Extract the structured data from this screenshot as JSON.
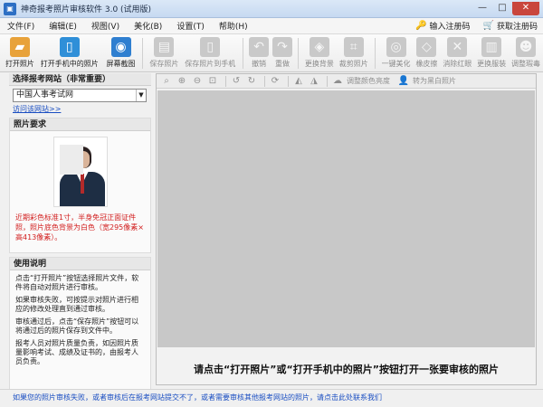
{
  "window": {
    "title": "神奇报考照片审核软件 3.0 (试用版)"
  },
  "menu": {
    "items": [
      "文件(F)",
      "编辑(E)",
      "视图(V)",
      "美化(B)",
      "设置(T)",
      "帮助(H)"
    ],
    "register_label": "输入注册码",
    "buy_label": "获取注册码"
  },
  "toolbar": {
    "buttons": [
      {
        "label": "打开照片",
        "icon": "folder-icon",
        "color": "#e8a23a"
      },
      {
        "label": "打开手机中的照片",
        "icon": "phone-icon",
        "color": "#2f8fd8"
      },
      {
        "label": "屏幕截图",
        "icon": "camera-icon",
        "color": "#2f7fd0"
      },
      {
        "label": "保存照片",
        "icon": "save-icon"
      },
      {
        "label": "保存照片到手机",
        "icon": "phone-save-icon"
      },
      {
        "label": "撤销",
        "icon": "undo-icon"
      },
      {
        "label": "重做",
        "icon": "redo-icon"
      },
      {
        "label": "更换背景",
        "icon": "background-icon"
      },
      {
        "label": "裁剪照片",
        "icon": "crop-icon"
      },
      {
        "label": "一键美化",
        "icon": "beautify-icon"
      },
      {
        "label": "橡皮擦",
        "icon": "eraser-icon"
      },
      {
        "label": "消除红眼",
        "icon": "red-eye-icon"
      },
      {
        "label": "更换服装",
        "icon": "clothes-icon"
      },
      {
        "label": "调整瑕毒",
        "icon": "head-icon"
      }
    ]
  },
  "canvas_toolbar": {
    "brightness_label": "调整颜色亮度",
    "grayscale_label": "转为黑白照片"
  },
  "left": {
    "site_title": "选择报考网站（非常重要）",
    "site_value": "中国人事考试网",
    "visit_link": "访问该网站>>",
    "req_title": "照片要求",
    "req_text": "近期彩色标准1寸，半身免冠正面证件照，照片底色背景为白色（宽295像素×高413像素）。",
    "guide_title": "使用说明",
    "guide": [
      "点击“打开照片”按钮选择照片文件，软件将自动对照片进行审核。",
      "如果审核失败，可按提示对照片进行相应的修改处理直到通过审核。",
      "审核通过后，点击“保存照片”按钮可以将通过后的照片保存到文件中。",
      "报考人员对照片质量负责，如因照片质量影响考试、成绩及证书的，由报考人员负责。"
    ]
  },
  "main": {
    "hint": "请点击“打开照片”或“打开手机中的照片”按钮打开一张要审核的照片"
  },
  "status": {
    "text": "如果您的照片审核失败，或者审核后在报考网站提交不了，或者需要审核其他报考网站的照片，请点击此处联系我们"
  }
}
